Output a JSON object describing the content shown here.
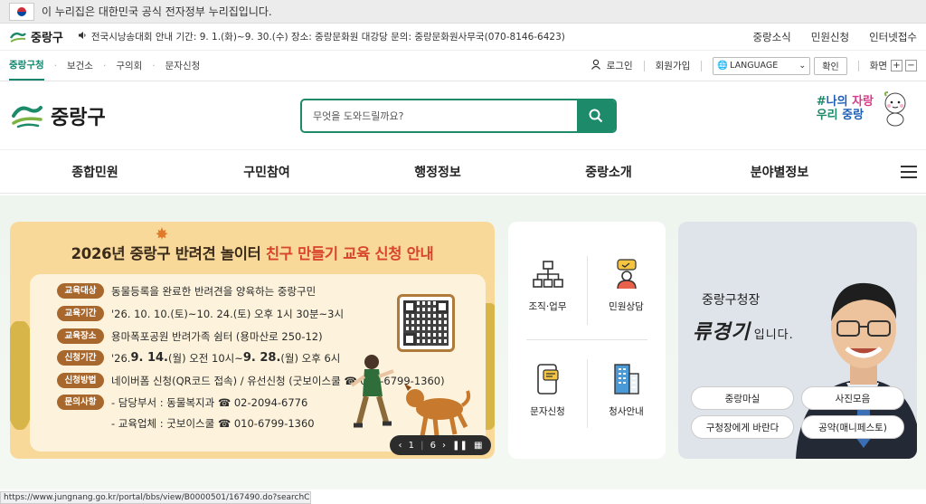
{
  "gov_banner": {
    "text": "이 누리집은 대한민국 공식 전자정부 누리집입니다."
  },
  "top_bar": {
    "logo": "중랑구",
    "notice": "전국시낭송대회 안내 기간: 9. 1.(화)~9. 30.(수) 장소: 중랑문화원 대강당 문의: 중랑문화원사무국(070-8146-6423)",
    "links": [
      "중랑소식",
      "민원신청",
      "인터넷접수"
    ]
  },
  "subsites": {
    "items": [
      "중랑구청",
      "보건소",
      "구의회",
      "문자신청"
    ],
    "active": 0
  },
  "util": {
    "login": "로그인",
    "signup": "회원가입",
    "language": "LANGUAGE",
    "confirm": "확인",
    "screen": "화면",
    "zoom_in": "+",
    "zoom_out": "−"
  },
  "header": {
    "logo": "중랑구",
    "search_placeholder": "무엇을 도와드릴까요?",
    "slogan_line1_a": "#",
    "slogan_line1_b": "나의 ",
    "slogan_line1_c": "자랑",
    "slogan_line2_a": "우리 ",
    "slogan_line2_b": "중랑"
  },
  "gnb": {
    "items": [
      "종합민원",
      "구민참여",
      "행정정보",
      "중랑소개",
      "분야별정보"
    ]
  },
  "banner": {
    "title_a": "2026년 중랑구 반려견 놀이터 ",
    "title_b": "친구 만들기 교육 신청 안내",
    "rows": [
      {
        "tag": "교육대상",
        "text": "동물등록을 완료한 반려견을 양육하는 중랑구민"
      },
      {
        "tag": "교육기간",
        "text": "'26. 10. 10.(토)~10. 24.(토) 오후 1시 30분~3시"
      },
      {
        "tag": "교육장소",
        "text": "용마폭포공원 반려가족 쉼터 (용마산로 250-12)"
      },
      {
        "tag": "신청기간",
        "pre": "'26. ",
        "b1": "9. 14.",
        "mid": "(월) 오전 10시~",
        "b2": "9. 28.",
        "post": "(월) 오후 6시"
      },
      {
        "tag": "신청방법",
        "text": "네이버폼 신청(QR코드 접속) / 유선신청 (굿보이스쿨 ☎ 010-6799-1360)"
      },
      {
        "tag": "문의사항",
        "text": "- 담당부서 : 동물복지과 ☎ 02-2094-6776"
      },
      {
        "tag": "",
        "text": "- 교육업체 : 굿보이스쿨 ☎ 010-6799-1360"
      }
    ],
    "pager": {
      "current": "1",
      "total": "6"
    }
  },
  "quick": {
    "items": [
      "조직·업무",
      "민원상담",
      "문자신청",
      "청사안내"
    ]
  },
  "mayor": {
    "label": "중랑구청장",
    "name": "류경기",
    "suffix": "입니다.",
    "buttons": [
      "중랑마실",
      "사진모음",
      "구청장에게 바란다",
      "공약(매니페스토)"
    ]
  },
  "status_url": "https://www.jungnang.go.kr/portal/bbs/view/B0000501/167490.do?searchCnd=&..."
}
